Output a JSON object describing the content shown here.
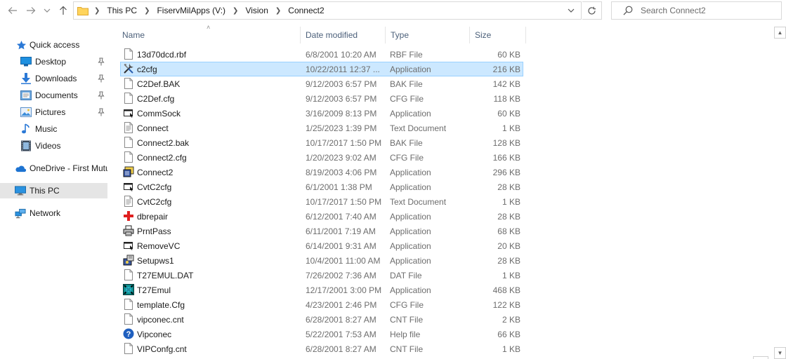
{
  "address": {
    "crumbs": [
      "This PC",
      "FiservMilApps (V:)",
      "Vision",
      "Connect2"
    ]
  },
  "search": {
    "placeholder": "Search Connect2"
  },
  "nav": {
    "items": [
      {
        "label": "Quick access",
        "icon": "star-icon",
        "pinned": false
      },
      {
        "label": "Desktop",
        "icon": "desktop-icon",
        "pinned": true
      },
      {
        "label": "Downloads",
        "icon": "download-icon",
        "pinned": true
      },
      {
        "label": "Documents",
        "icon": "documents-icon",
        "pinned": true
      },
      {
        "label": "Pictures",
        "icon": "pictures-icon",
        "pinned": true
      },
      {
        "label": "Music",
        "icon": "music-icon",
        "pinned": false
      },
      {
        "label": "Videos",
        "icon": "videos-icon",
        "pinned": false
      },
      {
        "label": "OneDrive - First Mutu",
        "icon": "cloud-icon",
        "pinned": false
      },
      {
        "label": "This PC",
        "icon": "computer-icon",
        "pinned": false,
        "selected": true
      },
      {
        "label": "Network",
        "icon": "network-icon",
        "pinned": false
      }
    ]
  },
  "columns": {
    "name": "Name",
    "date": "Date modified",
    "type": "Type",
    "size": "Size"
  },
  "files": [
    {
      "name": "13d70dcd.rbf",
      "date": "6/8/2001 10:20 AM",
      "type": "RBF File",
      "size": "60 KB",
      "icon": "generic-file-icon"
    },
    {
      "name": "c2cfg",
      "date": "10/22/2011 12:37 ...",
      "type": "Application",
      "size": "216 KB",
      "icon": "tools-app-icon",
      "selected": true
    },
    {
      "name": "C2Def.BAK",
      "date": "9/12/2003 6:57 PM",
      "type": "BAK File",
      "size": "142 KB",
      "icon": "generic-file-icon"
    },
    {
      "name": "C2Def.cfg",
      "date": "9/12/2003 6:57 PM",
      "type": "CFG File",
      "size": "118 KB",
      "icon": "generic-file-icon"
    },
    {
      "name": "CommSock",
      "date": "3/16/2009 8:13 PM",
      "type": "Application",
      "size": "60 KB",
      "icon": "app-window-icon"
    },
    {
      "name": "Connect",
      "date": "1/25/2023 1:39 PM",
      "type": "Text Document",
      "size": "1 KB",
      "icon": "text-file-icon"
    },
    {
      "name": "Connect2.bak",
      "date": "10/17/2017 1:50 PM",
      "type": "BAK File",
      "size": "128 KB",
      "icon": "generic-file-icon"
    },
    {
      "name": "Connect2.cfg",
      "date": "1/20/2023 9:02 AM",
      "type": "CFG File",
      "size": "166 KB",
      "icon": "generic-file-icon"
    },
    {
      "name": "Connect2",
      "date": "8/19/2003 4:06 PM",
      "type": "Application",
      "size": "296 KB",
      "icon": "connect-app-icon"
    },
    {
      "name": "CvtC2cfg",
      "date": "6/1/2001 1:38 PM",
      "type": "Application",
      "size": "28 KB",
      "icon": "app-window-icon"
    },
    {
      "name": "CvtC2cfg",
      "date": "10/17/2017 1:50 PM",
      "type": "Text Document",
      "size": "1 KB",
      "icon": "text-file-icon"
    },
    {
      "name": "dbrepair",
      "date": "6/12/2001 7:40 AM",
      "type": "Application",
      "size": "28 KB",
      "icon": "red-cross-icon"
    },
    {
      "name": "PrntPass",
      "date": "6/11/2001 7:19 AM",
      "type": "Application",
      "size": "68 KB",
      "icon": "printer-icon"
    },
    {
      "name": "RemoveVC",
      "date": "6/14/2001 9:31 AM",
      "type": "Application",
      "size": "20 KB",
      "icon": "app-window-icon"
    },
    {
      "name": "Setupws1",
      "date": "10/4/2001 11:00 AM",
      "type": "Application",
      "size": "28 KB",
      "icon": "setup-icon"
    },
    {
      "name": "T27EMUL.DAT",
      "date": "7/26/2002 7:36 AM",
      "type": "DAT File",
      "size": "1 KB",
      "icon": "generic-file-icon"
    },
    {
      "name": "T27Emul",
      "date": "12/17/2001 3:00 PM",
      "type": "Application",
      "size": "468 KB",
      "icon": "emulator-icon"
    },
    {
      "name": "template.Cfg",
      "date": "4/23/2001 2:46 PM",
      "type": "CFG File",
      "size": "122 KB",
      "icon": "generic-file-icon"
    },
    {
      "name": "vipconec.cnt",
      "date": "6/28/2001 8:27 AM",
      "type": "CNT File",
      "size": "2 KB",
      "icon": "generic-file-icon"
    },
    {
      "name": "Vipconec",
      "date": "5/22/2001 7:53 AM",
      "type": "Help file",
      "size": "66 KB",
      "icon": "help-icon"
    },
    {
      "name": "VIPConfg.cnt",
      "date": "6/28/2001 8:27 AM",
      "type": "CNT File",
      "size": "1 KB",
      "icon": "generic-file-icon"
    }
  ],
  "colors": {
    "selected_row": "#cce8ff",
    "selected_border": "#99d1ff",
    "nav_selected": "#e5e5e5",
    "header_text": "#4c607a"
  }
}
